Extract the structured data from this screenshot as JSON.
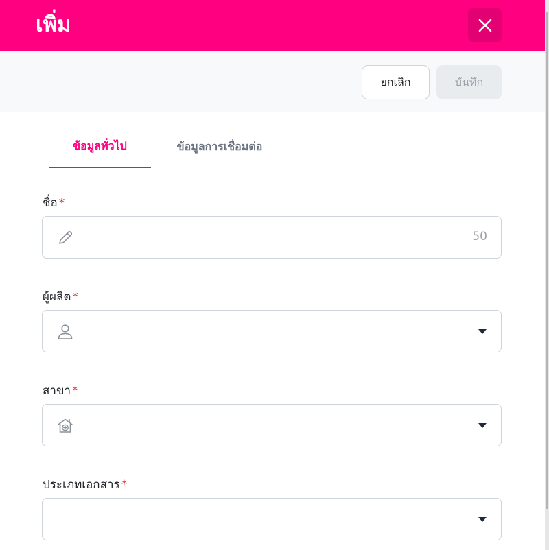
{
  "header": {
    "title": "เพิ่ม"
  },
  "toolbar": {
    "cancel_label": "ยกเลิก",
    "save_label": "บันทึก"
  },
  "tabs": [
    {
      "label": "ข้อมูลทั่วไป",
      "active": true
    },
    {
      "label": "ข้อมูลการเชื่อมต่อ",
      "active": false
    }
  ],
  "form": {
    "required_mark": "*",
    "name": {
      "label": "ชื่อ",
      "value": "",
      "counter": "50",
      "icon": "pencil-icon"
    },
    "manufacturer": {
      "label": "ผู้ผลิต",
      "value": "",
      "icon": "user-icon"
    },
    "branch": {
      "label": "สาขา",
      "value": "",
      "icon": "clinic-icon"
    },
    "document_type": {
      "label": "ประเภทเอกสาร",
      "value": ""
    }
  },
  "colors": {
    "brand": "#ff0080",
    "brand_dark": "#e30072",
    "required": "#dc2626"
  }
}
